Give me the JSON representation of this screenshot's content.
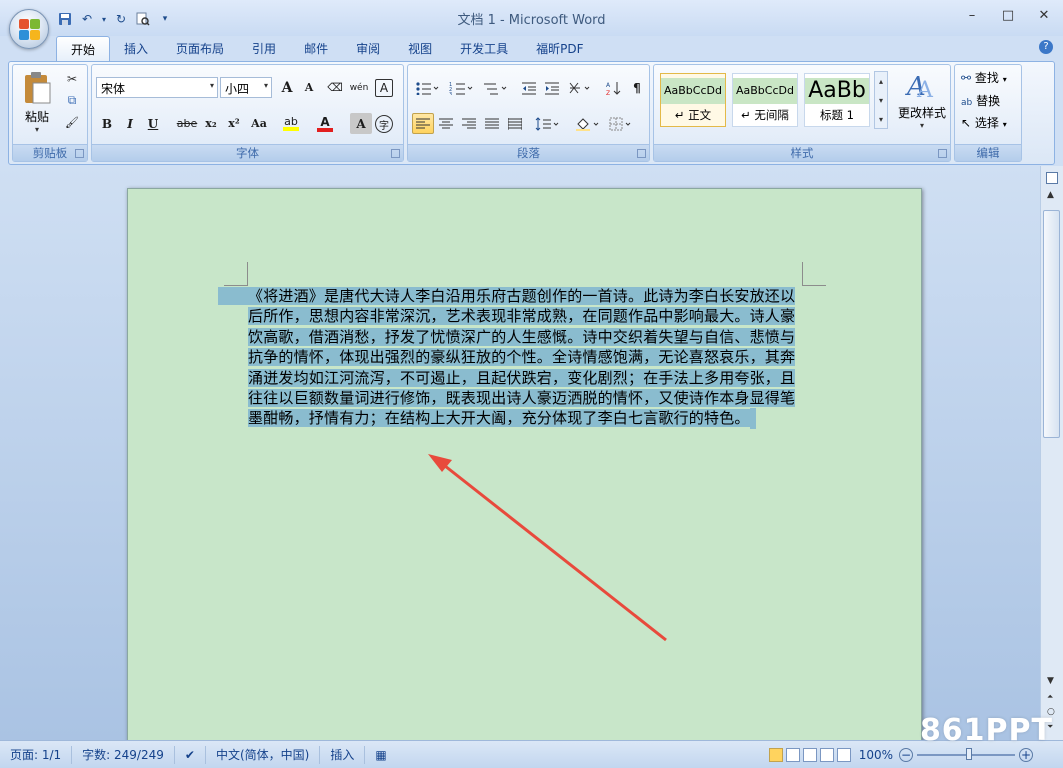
{
  "window": {
    "title": "文档 1 - Microsoft Word",
    "minimize": "–",
    "maximize": "□",
    "close": "✕"
  },
  "qat": {
    "save": "💾",
    "undo": "↶",
    "redo": "↻",
    "preview": "🔍",
    "customize": "▾"
  },
  "tabs": [
    "开始",
    "插入",
    "页面布局",
    "引用",
    "邮件",
    "审阅",
    "视图",
    "开发工具",
    "福昕PDF"
  ],
  "help": "?",
  "clipboard": {
    "paste": "粘贴",
    "cut": "✂",
    "copy": "⧉",
    "format_painter": "🖌",
    "label": "剪贴板"
  },
  "font": {
    "name": "宋体",
    "size": "小四",
    "label": "字体",
    "grow": "A",
    "shrink": "A",
    "clear": "⌫",
    "phonetic": "wén",
    "border_char": "A",
    "bold": "B",
    "italic": "I",
    "underline": "U",
    "strike": "abe",
    "sub": "x₂",
    "sup": "x²",
    "case": "Aa",
    "highlight": "ab",
    "color": "A",
    "shade": "A",
    "enclose": "字"
  },
  "paragraph": {
    "label": "段落"
  },
  "styles": {
    "label": "样式",
    "items": [
      {
        "preview": "AaBbCcDd",
        "name": "↵ 正文"
      },
      {
        "preview": "AaBbCcDd",
        "name": "↵ 无间隔"
      },
      {
        "preview": "AaBb",
        "name": "标题 1"
      }
    ],
    "change": "更改样式"
  },
  "editing": {
    "label": "编辑",
    "find": "查找",
    "replace": "替换",
    "select": "选择"
  },
  "document": {
    "text": "《将进酒》是唐代大诗人李白沿用乐府古题创作的一首诗。此诗为李白长安放还以后所作，思想内容非常深沉，艺术表现非常成熟，在同题作品中影响最大。诗人豪饮高歌，借酒消愁，抒发了忧愤深广的人生感慨。诗中交织着失望与自信、悲愤与抗争的情怀，体现出强烈的豪纵狂放的个性。全诗情感饱满，无论喜怒哀乐，其奔涌迸发均如江河流泻，不可遏止，且起伏跌宕，变化剧烈；在手法上多用夸张，且往往以巨额数量词进行修饰，既表现出诗人豪迈洒脱的情怀，又使诗作本身显得笔墨酣畅，抒情有力；在结构上大开大阖，充分体现了李白七言歌行的特色。"
  },
  "status": {
    "page": "页面: 1/1",
    "words": "字数: 249/249",
    "lang": "中文(简体，中国)",
    "mode": "插入",
    "zoom": "100%"
  },
  "watermark": "861PPT",
  "colors": {
    "page_bg": "#c8e6c9",
    "selection": "#8abccf",
    "arrow": "#e84a3c"
  }
}
